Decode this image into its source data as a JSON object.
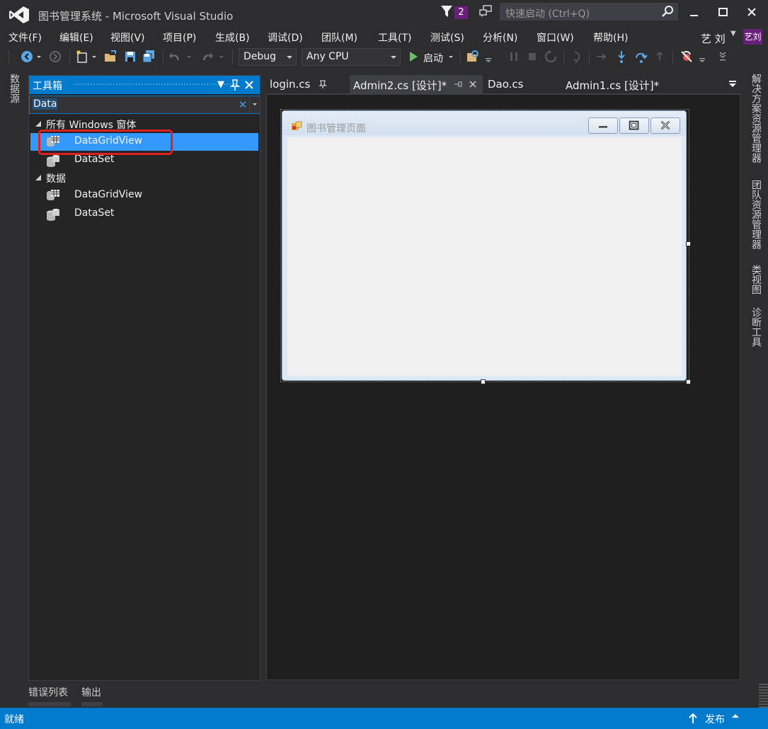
{
  "app": {
    "title": "图书管理系统 - Microsoft Visual Studio",
    "notification_count": "2",
    "quick_launch_placeholder": "快速启动 (Ctrl+Q)",
    "user_name": "艺 刘",
    "user_avatar": "艺刘"
  },
  "menu": {
    "items": [
      "文件(F)",
      "编辑(E)",
      "视图(V)",
      "项目(P)",
      "生成(B)",
      "调试(D)",
      "团队(M)",
      "工具(T)",
      "测试(S)",
      "分析(N)",
      "窗口(W)",
      "帮助(H)"
    ]
  },
  "toolbar": {
    "config": "Debug",
    "platform": "Any CPU",
    "start_label": "启动"
  },
  "left_strip": {
    "datasource_tab": "数据源"
  },
  "toolbox": {
    "title": "工具箱",
    "search_value": "Data",
    "groups": [
      {
        "label": "所有 Windows 窗体",
        "items": [
          "DataGridView",
          "DataSet"
        ]
      },
      {
        "label": "数据",
        "items": [
          "DataGridView",
          "DataSet"
        ]
      }
    ],
    "selected_item": "DataGridView"
  },
  "doc_tabs": [
    "login.cs",
    "Admin2.cs [设计]*",
    "Dao.cs",
    "Admin1.cs [设计]*"
  ],
  "designer": {
    "form_title": "图书管理页面"
  },
  "right_strip": {
    "tabs": [
      "解决方案资源管理器",
      "团队资源管理器",
      "类视图",
      "诊断工具"
    ]
  },
  "bottom_tabs": [
    "错误列表",
    "输出"
  ],
  "status": {
    "text": "就绪",
    "publish_label": "发布"
  },
  "colors": {
    "accent": "#007acc",
    "selection": "#3399ff",
    "highlight_box": "#e02020",
    "badge": "#68217a"
  }
}
